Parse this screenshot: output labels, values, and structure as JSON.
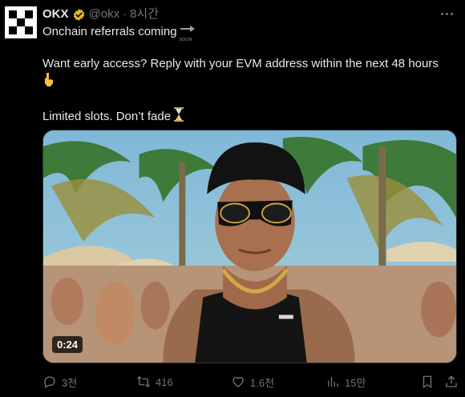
{
  "author": {
    "name": "OKX",
    "handle": "@okx",
    "separator": "·",
    "time": "8시간",
    "verified_color": "#e2b719"
  },
  "tweet": {
    "line1": "Onchain referrals coming",
    "soon_label": "SOON",
    "line2": "Want early access? Reply with your EVM address within the next 48 hours",
    "line2_emoji": "👇",
    "line3": "Limited slots. Don’t fade",
    "line3_emoji": "⌛"
  },
  "media": {
    "duration": "0:24"
  },
  "actions": {
    "replies": "3천",
    "retweets": "416",
    "likes": "1.6천",
    "views": "15만"
  },
  "colors": {
    "background": "#000000",
    "text": "#e7e9ea",
    "muted": "#71767b"
  }
}
